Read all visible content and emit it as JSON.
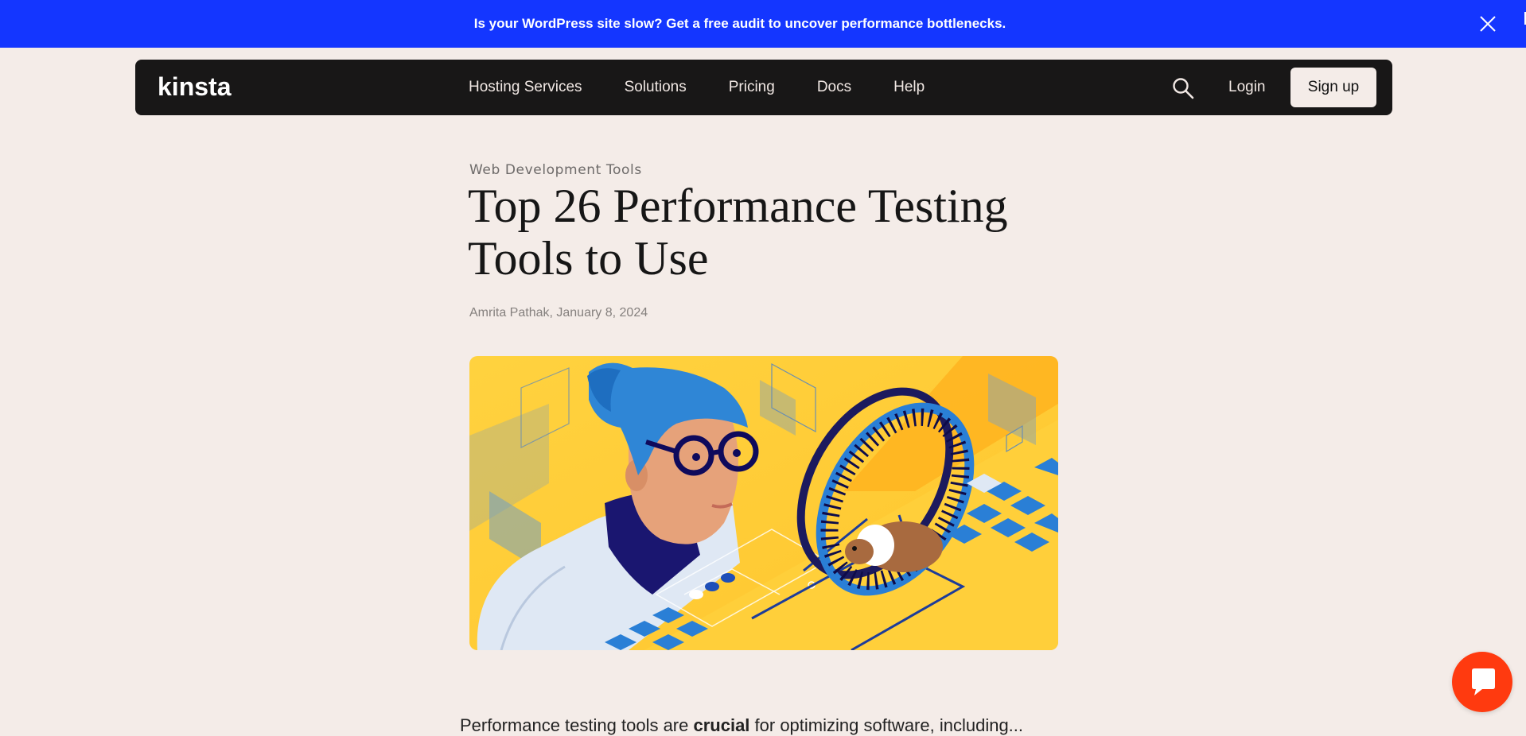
{
  "promo": {
    "text": "Is your WordPress site slow? Get a free audit to uncover performance bottlenecks."
  },
  "nav": {
    "logo": "kinsta",
    "links": [
      "Hosting Services",
      "Solutions",
      "Pricing",
      "Docs",
      "Help"
    ],
    "login": "Login",
    "signup": "Sign up"
  },
  "article": {
    "category": "Web Development Tools",
    "title": "Top 26 Performance Testing Tools to Use",
    "byline": "Amrita Pathak, January 8, 2024",
    "intro_visible_start": "Performance testing tools are ",
    "intro_visible_bold": "crucial",
    "intro_visible_end": " for optimizing software, including..."
  },
  "icons": {
    "close": "close-icon",
    "search": "search-icon",
    "chat": "chat-icon"
  },
  "colors": {
    "promo_bg": "#1436ff",
    "nav_bg": "#181717",
    "page_bg": "#f4ece8",
    "chat_bg": "#ff3a0f",
    "hero_yellow": "#ffd23f"
  }
}
